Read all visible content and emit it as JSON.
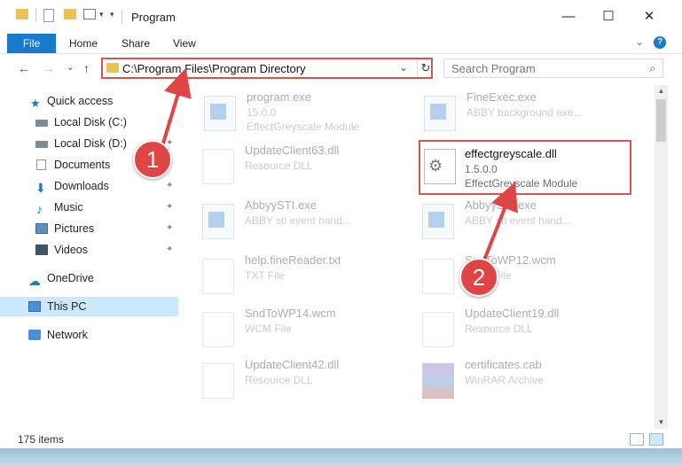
{
  "window": {
    "title": "Program",
    "minimize": "—",
    "maximize": "☐",
    "close": "✕"
  },
  "ribbon": {
    "file": "File",
    "tabs": [
      "Home",
      "Share",
      "View"
    ],
    "help": "?",
    "expand": "⌄"
  },
  "nav": {
    "back": "←",
    "forward": "→",
    "recent": "⌄",
    "up": "↑"
  },
  "address": {
    "path": "C:\\Program Files\\Program Directory",
    "dropdown": "⌄",
    "refresh": "↻"
  },
  "search": {
    "placeholder": "Search Program",
    "icon": "⌕"
  },
  "sidebar": {
    "items": [
      {
        "label": "Quick access",
        "icon": "star-icon"
      },
      {
        "label": "Local Disk (C:)",
        "icon": "drive-icon"
      },
      {
        "label": "Local Disk (D:)",
        "icon": "drive-icon"
      },
      {
        "label": "Documents",
        "icon": "documents-icon"
      },
      {
        "label": "Downloads",
        "icon": "download-icon"
      },
      {
        "label": "Music",
        "icon": "music-icon"
      },
      {
        "label": "Pictures",
        "icon": "pictures-icon"
      },
      {
        "label": "Videos",
        "icon": "videos-icon"
      },
      {
        "label": "OneDrive",
        "icon": "cloud-icon"
      },
      {
        "label": "This PC",
        "icon": "computer-icon"
      },
      {
        "label": "Network",
        "icon": "network-icon"
      }
    ],
    "pin": "✦"
  },
  "files": [
    {
      "name": "program.exe",
      "l2": "15.0.0",
      "l3": "EffectGreyscale Module",
      "type": "app"
    },
    {
      "name": "FineExec.exe",
      "l2": "ABBY background exe...",
      "l3": "",
      "type": "app"
    },
    {
      "name": "UpdateClient63.dll",
      "l2": "Resource DLL",
      "l3": "",
      "type": "dll"
    },
    {
      "name": "effectgreyscale.dll",
      "l2": "1.5.0.0",
      "l3": "EffectGreyscale Module",
      "type": "dll"
    },
    {
      "name": "AbbyySTI.exe",
      "l2": "ABBY sti event hand...",
      "l3": "",
      "type": "app"
    },
    {
      "name": "AbbyySTI.exe",
      "l2": "ABBY sti event hand...",
      "l3": "",
      "type": "app"
    },
    {
      "name": "help.fineReader.txt",
      "l2": "TXT File",
      "l3": "",
      "type": "doc"
    },
    {
      "name": "SndToWP12.wcm",
      "l2": "WCM File",
      "l3": "",
      "type": "doc"
    },
    {
      "name": "SndToWP14.wcm",
      "l2": "WCM File",
      "l3": "",
      "type": "doc"
    },
    {
      "name": "UpdateClient19.dll",
      "l2": "Resource DLL",
      "l3": "",
      "type": "dll"
    },
    {
      "name": "UpdateClient42.dll",
      "l2": "Resource DLL",
      "l3": "",
      "type": "dll"
    },
    {
      "name": "certificates.cab",
      "l2": "WinRAR Archive",
      "l3": "",
      "type": "cab"
    }
  ],
  "status": {
    "count": "175 items"
  },
  "callouts": [
    "1",
    "2"
  ],
  "colors": {
    "accent": "#1979ca",
    "highlight": "#d9534f",
    "selected": "#cce8ff"
  }
}
